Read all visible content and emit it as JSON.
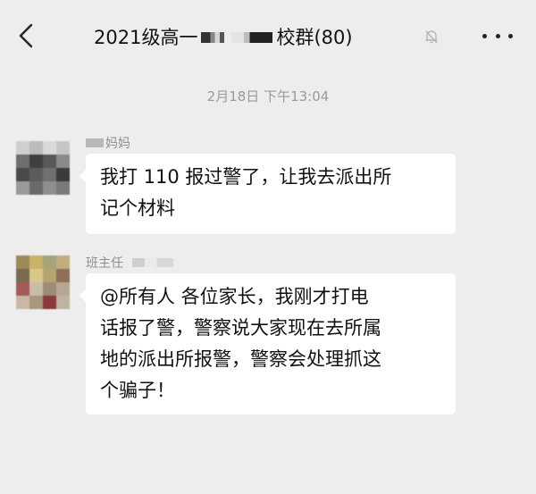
{
  "header": {
    "title_start": "2021级高一",
    "title_end": "校群(80)",
    "back_icon": "chevron-left-icon",
    "mute_icon": "bell-muted-icon",
    "more_icon": "more-dots-icon"
  },
  "timestamp": "2月18日 下午13:04",
  "messages": [
    {
      "sender": "妈妈",
      "lines": [
        "我打 110 报过警了，让我去派出所",
        "记个材料"
      ]
    },
    {
      "sender": "班主任",
      "lines": [
        "@所有人  各位家长，我刚才打电",
        "话报了警，警察说大家现在去所属",
        "地的派出所报警，警察会处理抓这",
        "个骗子！"
      ]
    }
  ],
  "colors": {
    "background": "#ededed",
    "bubble": "#ffffff",
    "meta_text": "#9a9a9a"
  }
}
